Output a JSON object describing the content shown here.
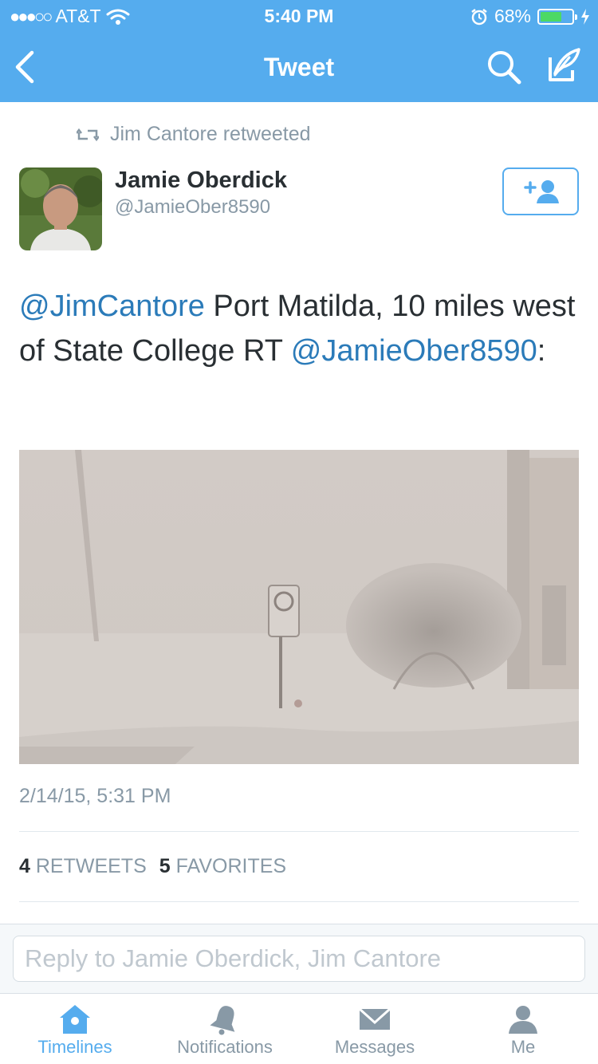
{
  "status_bar": {
    "signal": "●●●○○",
    "carrier": "AT&T",
    "time": "5:40 PM",
    "battery_percent": "68%",
    "battery_level": 0.68
  },
  "nav": {
    "title": "Tweet",
    "icons": [
      "back-chevron-icon",
      "search-icon",
      "compose-icon"
    ]
  },
  "tweet": {
    "retweeted_by": "Jim Cantore retweeted",
    "author_name": "Jamie Oberdick",
    "author_handle": "@JamieOber8590",
    "text": {
      "mention1": "@JimCantore",
      "body": " Port Matilda, 10 miles west of State College RT ",
      "mention2": "@JamieOber8590",
      "suffix": ":"
    },
    "timestamp": "2/14/15, 5:31 PM",
    "retweets_count": "4",
    "retweets_label": "RETWEETS",
    "favorites_count": "5",
    "favorites_label": "FAVORITES"
  },
  "reply": {
    "placeholder": "Reply to Jamie Oberdick, Jim Cantore"
  },
  "tabs": [
    {
      "label": "Timelines",
      "icon": "home-icon",
      "active": true
    },
    {
      "label": "Notifications",
      "icon": "bell-icon",
      "active": false
    },
    {
      "label": "Messages",
      "icon": "envelope-icon",
      "active": false
    },
    {
      "label": "Me",
      "icon": "person-icon",
      "active": false
    }
  ],
  "colors": {
    "accent": "#55acee",
    "link": "#2b7bb9",
    "muted": "#8899a6",
    "battery_fill": "#4cd964"
  }
}
